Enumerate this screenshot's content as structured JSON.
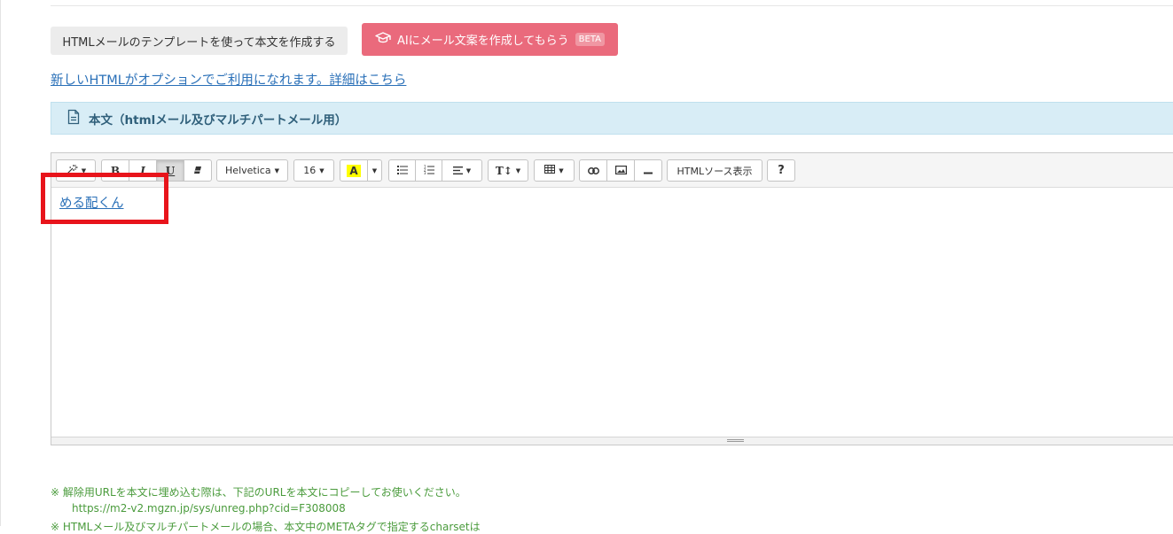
{
  "buttons": {
    "template_label": "HTMLメールのテンプレートを使って本文を作成する",
    "ai_label": "AIにメール文案を作成してもらう",
    "ai_badge": "BETA"
  },
  "option_link": "新しいHTMLがオプションでご利用になれます。詳細はこちら",
  "section": {
    "title": "本文（htmlメール及びマルチパートメール用）"
  },
  "toolbar": {
    "style_icon": "magic-wand-icon",
    "bold": "B",
    "italic": "I",
    "underline": "U",
    "eraser_icon": "eraser-icon",
    "font_name": "Helvetica",
    "font_size": "16",
    "color_letter": "A",
    "highlight_color": "#ffff00",
    "unordered_list_icon": "bullet-list-icon",
    "ordered_list_icon": "numbered-list-icon",
    "align_icon": "align-left-icon",
    "line_height_label": "T↕",
    "table_icon": "table-icon",
    "link_icon": "link-icon",
    "picture_icon": "image-icon",
    "hr_icon": "horizontal-rule-icon",
    "source_label": "HTMLソース表示",
    "help_label": "?"
  },
  "editor": {
    "content_link": "める配くん"
  },
  "notes": {
    "line1": "※ 解除用URLを本文に埋め込む際は、下記のURLを本文にコピーしてお使いください。",
    "url": "https://m2-v2.mgzn.jp/sys/unreg.php?cid=F308008",
    "line3": "※ HTMLメール及びマルチパートメールの場合、本文中のMETAタグで指定するcharsetは"
  },
  "colors": {
    "ai_button": "#ea6a7c",
    "link": "#2a70b8",
    "section_bg": "#d8edf6",
    "note_text": "#4a9b3c",
    "highlight_box": "#e8141b"
  }
}
